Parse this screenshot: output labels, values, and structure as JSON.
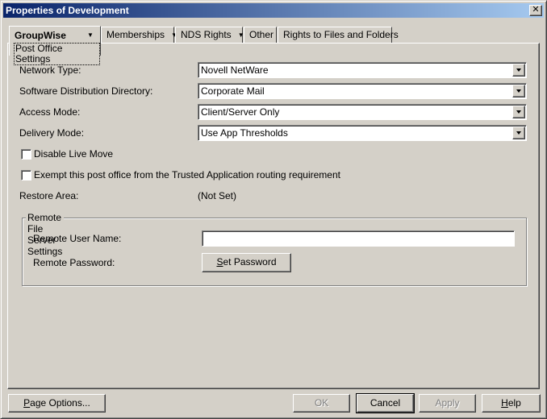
{
  "window": {
    "title": "Properties of Development",
    "close_glyph": "✕"
  },
  "tabs": {
    "active": {
      "label": "GroupWise",
      "sub_label": "Post Office Settings"
    },
    "items": [
      {
        "label": "Memberships",
        "has_menu": true
      },
      {
        "label": "NDS Rights",
        "has_menu": true
      },
      {
        "label": "Other",
        "has_menu": false
      },
      {
        "label": "Rights to Files and Folders",
        "has_menu": false
      }
    ],
    "menu_glyph": "▼"
  },
  "form": {
    "network_type": {
      "label": "Network Type:",
      "value": "Novell NetWare"
    },
    "software_distribution": {
      "label": "Software Distribution Directory:",
      "value": "Corporate Mail"
    },
    "access_mode": {
      "label": "Access Mode:",
      "value": "Client/Server Only"
    },
    "delivery_mode": {
      "label": "Delivery Mode:",
      "value": "Use App Thresholds"
    },
    "disable_live_move": {
      "label": "Disable Live Move",
      "checked": false
    },
    "exempt_trusted_app": {
      "label": "Exempt this post office from the Trusted Application routing requirement",
      "checked": false
    },
    "restore_area": {
      "label": "Restore Area:",
      "value": "(Not Set)"
    }
  },
  "remote": {
    "group_title": "Remote File Server Settings",
    "user_name_label": "Remote User Name:",
    "user_name_value": "",
    "password_label": "Remote Password:",
    "set_password_button": {
      "mnemonic": "S",
      "rest": "et Password"
    }
  },
  "footer": {
    "page_options": {
      "mnemonic": "P",
      "rest": "age Options..."
    },
    "ok": "OK",
    "cancel": "Cancel",
    "apply": "Apply",
    "help": {
      "mnemonic": "H",
      "rest": "elp"
    }
  }
}
